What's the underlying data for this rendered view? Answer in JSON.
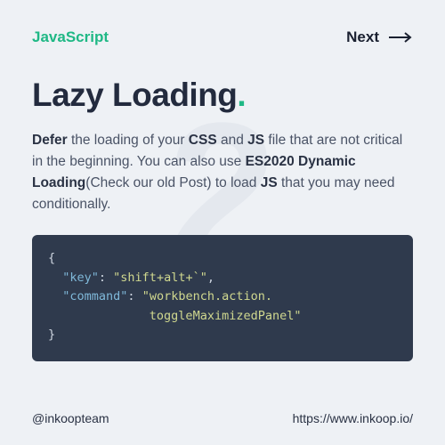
{
  "header": {
    "brand": "JavaScript",
    "next_label": "Next"
  },
  "watermark": "2",
  "title": "Lazy Loading",
  "title_dot": ".",
  "desc": {
    "bold1": "Defer",
    "text1": " the loading of your ",
    "bold2": "CSS",
    "text2": " and ",
    "bold3": "JS",
    "text3": " file that are not critical in the beginning. You can also use ",
    "bold4": "ES2020 Dynamic Loading",
    "text4": "(Check our old Post) to load ",
    "bold5": "JS",
    "text5": " that you may need conditionally."
  },
  "code": {
    "open": "{",
    "line1_key": "\"key\"",
    "line1_colon": ": ",
    "line1_val": "\"shift+alt+`\"",
    "line1_comma": ",",
    "line2_key": "\"command\"",
    "line2_colon": ": ",
    "line2_val_a": "\"workbench.action.",
    "line2_val_b": "toggleMaximizedPanel\"",
    "close": "}"
  },
  "footer": {
    "handle": "@inkoopteam",
    "url": "https://www.inkoop.io/"
  }
}
